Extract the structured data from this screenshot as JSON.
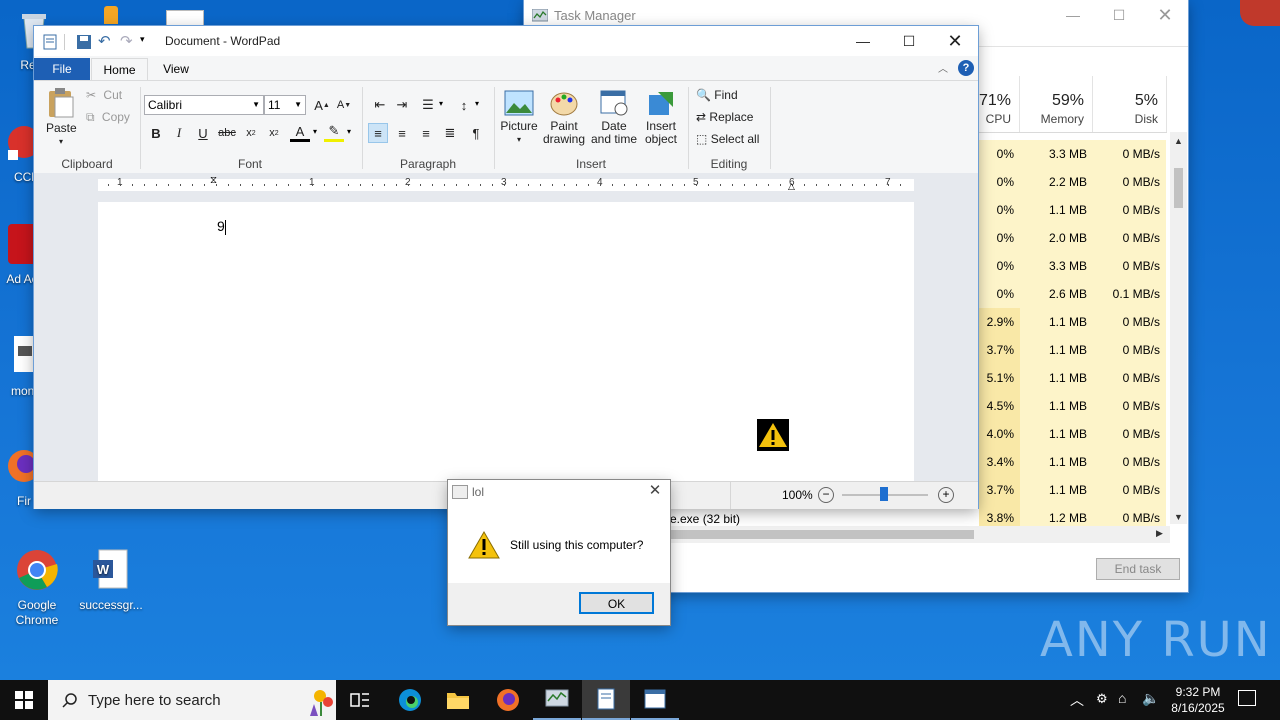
{
  "desktop": {
    "icons": [
      {
        "label": "Recy"
      },
      {
        "label": "CCl"
      },
      {
        "label": "Ad Acr"
      },
      {
        "label": "moni"
      },
      {
        "label": "Fir"
      },
      {
        "label": "Google Chrome"
      },
      {
        "label": "successgr..."
      }
    ],
    "watermark": "ANY RUN"
  },
  "task_manager": {
    "title": "Task Manager",
    "columns": [
      {
        "pct": "71%",
        "label": "CPU"
      },
      {
        "pct": "59%",
        "label": "Memory"
      },
      {
        "pct": "5%",
        "label": "Disk"
      }
    ],
    "rows": [
      {
        "cpu": "0%",
        "mem": "3.3 MB",
        "disk": "0 MB/s"
      },
      {
        "cpu": "0%",
        "mem": "2.2 MB",
        "disk": "0 MB/s"
      },
      {
        "cpu": "0%",
        "mem": "1.1 MB",
        "disk": "0 MB/s"
      },
      {
        "cpu": "0%",
        "mem": "2.0 MB",
        "disk": "0 MB/s"
      },
      {
        "cpu": "0%",
        "mem": "3.3 MB",
        "disk": "0 MB/s"
      },
      {
        "cpu": "0%",
        "mem": "2.6 MB",
        "disk": "0.1 MB/s"
      },
      {
        "cpu": "2.9%",
        "mem": "1.1 MB",
        "disk": "0 MB/s"
      },
      {
        "cpu": "3.7%",
        "mem": "1.1 MB",
        "disk": "0 MB/s"
      },
      {
        "cpu": "5.1%",
        "mem": "1.1 MB",
        "disk": "0 MB/s"
      },
      {
        "cpu": "4.5%",
        "mem": "1.1 MB",
        "disk": "0 MB/s"
      },
      {
        "cpu": "4.0%",
        "mem": "1.1 MB",
        "disk": "0 MB/s"
      },
      {
        "cpu": "3.4%",
        "mem": "1.1 MB",
        "disk": "0 MB/s"
      },
      {
        "cpu": "3.7%",
        "mem": "1.1 MB",
        "disk": "0 MB/s"
      },
      {
        "cpu": "3.8%",
        "mem": "1.2 MB",
        "disk": "0 MB/s"
      }
    ],
    "partial_process_name": "e.exe (32 bit)",
    "end_task": "End task"
  },
  "wordpad": {
    "title": "Document - WordPad",
    "tabs": {
      "file": "File",
      "home": "Home",
      "view": "View"
    },
    "clipboard": {
      "paste": "Paste",
      "cut": "Cut",
      "copy": "Copy",
      "group": "Clipboard"
    },
    "font": {
      "name": "Calibri",
      "size": "11",
      "group": "Font"
    },
    "paragraph": {
      "group": "Paragraph"
    },
    "insert": {
      "picture": "Picture",
      "paint": "Paint drawing",
      "datetime": "Date and time",
      "object": "Insert object",
      "group": "Insert"
    },
    "editing": {
      "find": "Find",
      "replace": "Replace",
      "select_all": "Select all",
      "group": "Editing"
    },
    "ruler": [
      "1",
      "1",
      "2",
      "3",
      "4",
      "5",
      "6",
      "7"
    ],
    "document_text": "9",
    "zoom": "100%"
  },
  "dialog": {
    "title": "lol",
    "message": "Still using this computer?",
    "ok": "OK"
  },
  "taskbar": {
    "search_placeholder": "Type here to search",
    "time": "9:32 PM",
    "date": "8/16/2025"
  }
}
